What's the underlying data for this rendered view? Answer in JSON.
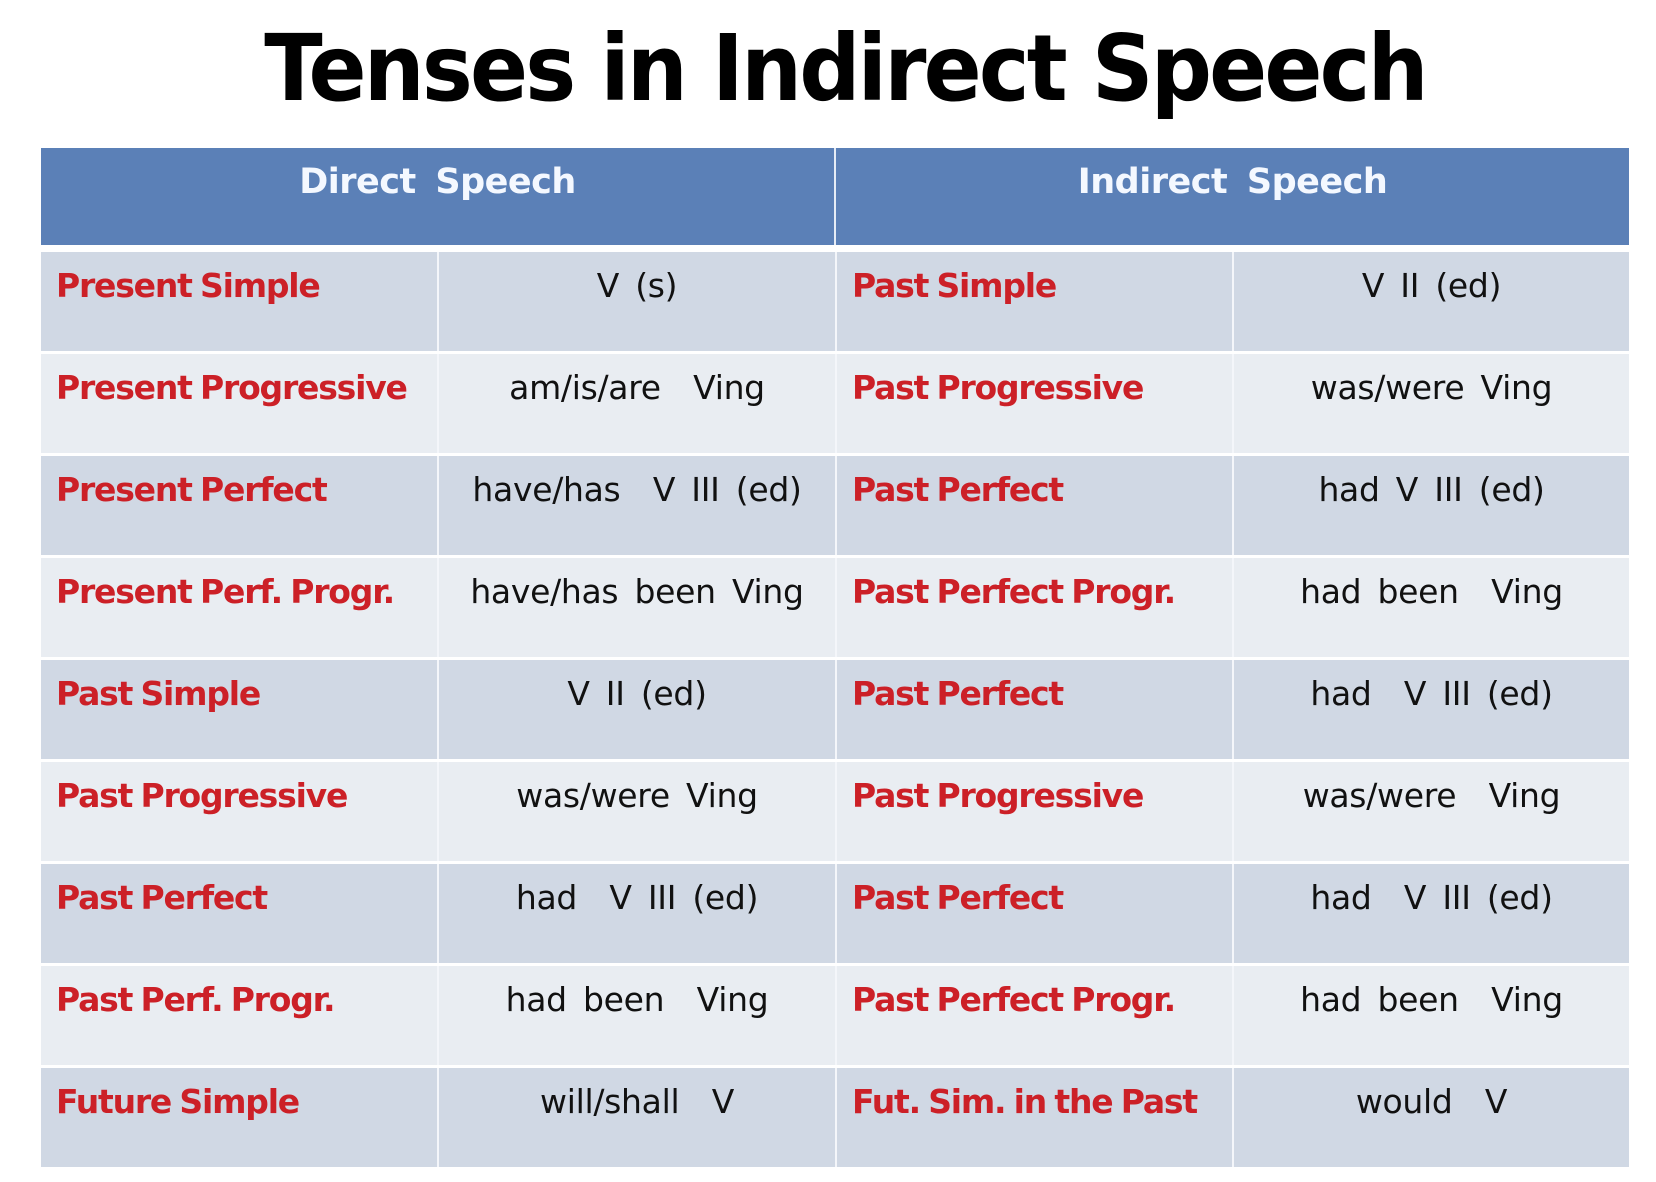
{
  "title": "Tenses in Indirect Speech",
  "colors": {
    "header_bg": "#5b80b7",
    "tense_text": "#cc2027",
    "row_dark": "#d0d8e4",
    "row_light": "#e9edf2"
  },
  "table": {
    "headers": [
      "Direct  Speech",
      "Indirect  Speech"
    ],
    "rows": [
      {
        "direct_tense": "Present Simple",
        "direct_form": "V (s)",
        "indirect_tense": "Past Simple",
        "indirect_form": "V II (ed)"
      },
      {
        "direct_tense": "Present Progressive",
        "direct_form": "am/is/are  Ving",
        "indirect_tense": "Past Progressive",
        "indirect_form": "was/were Ving"
      },
      {
        "direct_tense": "Present Perfect",
        "direct_form": "have/has  V III (ed)",
        "indirect_tense": "Past Perfect",
        "indirect_form": "had V III (ed)"
      },
      {
        "direct_tense": "Present Perf. Progr.",
        "direct_form": "have/has been Ving",
        "indirect_tense": "Past Perfect Progr.",
        "indirect_form": "had been  Ving"
      },
      {
        "direct_tense": "Past Simple",
        "direct_form": "V II (ed)",
        "indirect_tense": "Past Perfect",
        "indirect_form": "had  V III (ed)"
      },
      {
        "direct_tense": "Past Progressive",
        "direct_form": "was/were Ving",
        "indirect_tense": "Past Progressive",
        "indirect_form": "was/were  Ving"
      },
      {
        "direct_tense": "Past Perfect",
        "direct_form": "had  V III (ed)",
        "indirect_tense": "Past Perfect",
        "indirect_form": "had  V III (ed)"
      },
      {
        "direct_tense": "Past Perf. Progr.",
        "direct_form": "had been  Ving",
        "indirect_tense": "Past Perfect Progr.",
        "indirect_form": "had been  Ving"
      },
      {
        "direct_tense": "Future Simple",
        "direct_form": "will/shall  V",
        "indirect_tense": "Fut. Sim. in the Past",
        "indirect_form": "would  V"
      }
    ]
  }
}
